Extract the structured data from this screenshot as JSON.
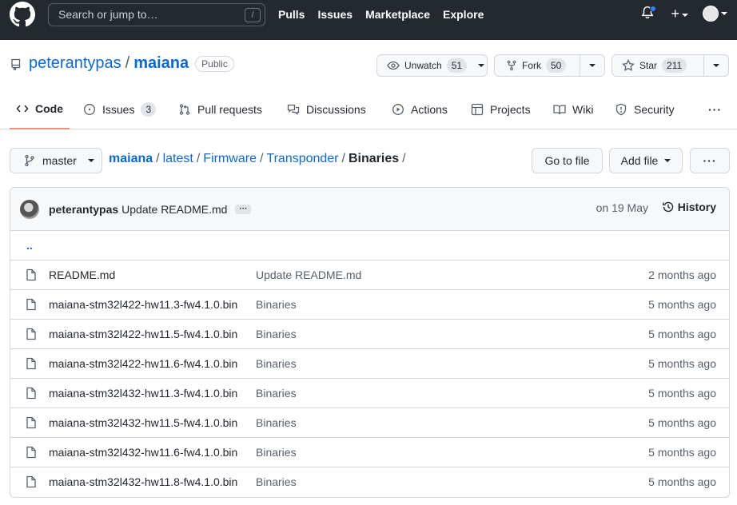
{
  "header": {
    "search_placeholder": "Search or jump to…",
    "search_shortcut": "/",
    "nav": [
      "Pulls",
      "Issues",
      "Marketplace",
      "Explore"
    ],
    "plus": "+"
  },
  "repo": {
    "owner": "peterantypas",
    "separator": "/",
    "name": "maiana",
    "visibility": "Public",
    "unwatch_label": "Unwatch",
    "unwatch_count": "51",
    "fork_label": "Fork",
    "fork_count": "50",
    "star_label": "Star",
    "star_count": "211"
  },
  "tabs": [
    {
      "label": "Code",
      "active": true
    },
    {
      "label": "Issues",
      "count": "3"
    },
    {
      "label": "Pull requests"
    },
    {
      "label": "Discussions"
    },
    {
      "label": "Actions"
    },
    {
      "label": "Projects"
    },
    {
      "label": "Wiki"
    },
    {
      "label": "Security"
    }
  ],
  "more_label": "···",
  "branch": "master",
  "breadcrumb": {
    "repo": "maiana",
    "parts": [
      "latest",
      "Firmware",
      "Transponder"
    ],
    "current": "Binaries",
    "sep": "/"
  },
  "buttons": {
    "go_to_file": "Go to file",
    "add_file": "Add file",
    "more": "···"
  },
  "commit": {
    "author": "peterantypas",
    "message": "Update README.md",
    "ellipsis": "···",
    "date": "on 19 May",
    "history_label": "History"
  },
  "updir": "..",
  "files": [
    {
      "name": "README.md",
      "message": "Update README.md",
      "age": "2 months ago"
    },
    {
      "name": "maiana-stm32l422-hw11.3-fw4.1.0.bin",
      "message": "Binaries",
      "age": "5 months ago"
    },
    {
      "name": "maiana-stm32l422-hw11.5-fw4.1.0.bin",
      "message": "Binaries",
      "age": "5 months ago"
    },
    {
      "name": "maiana-stm32l422-hw11.6-fw4.1.0.bin",
      "message": "Binaries",
      "age": "5 months ago"
    },
    {
      "name": "maiana-stm32l432-hw11.3-fw4.1.0.bin",
      "message": "Binaries",
      "age": "5 months ago"
    },
    {
      "name": "maiana-stm32l432-hw11.5-fw4.1.0.bin",
      "message": "Binaries",
      "age": "5 months ago"
    },
    {
      "name": "maiana-stm32l432-hw11.6-fw4.1.0.bin",
      "message": "Binaries",
      "age": "5 months ago"
    },
    {
      "name": "maiana-stm32l432-hw11.8-fw4.1.0.bin",
      "message": "Binaries",
      "age": "5 months ago"
    }
  ],
  "colors": {
    "header_bg": "#24292f",
    "link": "#0969da",
    "active_tab_underline": "#fd8c73",
    "notification_dot": "#2f81f7"
  }
}
